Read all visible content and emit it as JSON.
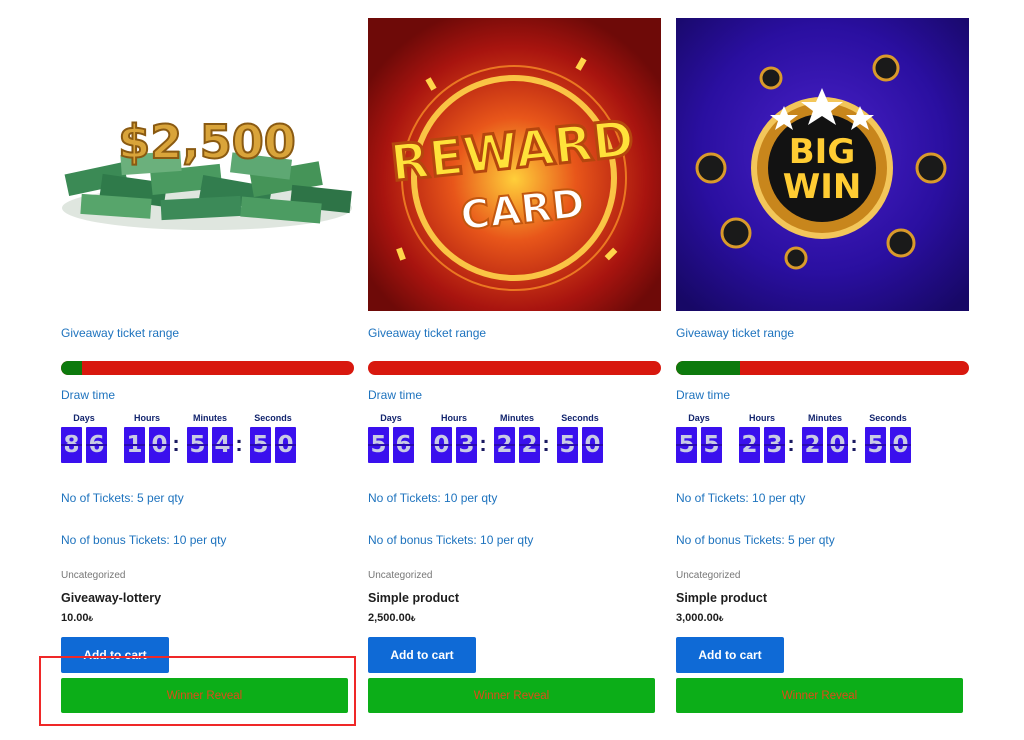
{
  "products": [
    {
      "image_text": "$2,500",
      "ticket_range_label": "Giveaway ticket range",
      "progress": 0.07,
      "draw_time_label": "Draw time",
      "countdown": {
        "days_label": "Days",
        "hours_label": "Hours",
        "minutes_label": "Minutes",
        "seconds_label": "Seconds",
        "days": "86",
        "hours": "10",
        "minutes": "54",
        "seconds": "50"
      },
      "tickets": "No of Tickets: 5 per qty",
      "bonus_tickets": "No of bonus Tickets: 10 per qty",
      "category": "Uncategorized",
      "title": "Giveaway-lottery",
      "price": "10.00",
      "currency": "₺",
      "add_to_cart": "Add to cart",
      "winner_reveal": "Winner Reveal"
    },
    {
      "image_text": "REWARD CARD",
      "ticket_range_label": "Giveaway ticket range",
      "progress": 0.0,
      "draw_time_label": "Draw time",
      "countdown": {
        "days_label": "Days",
        "hours_label": "Hours",
        "minutes_label": "Minutes",
        "seconds_label": "Seconds",
        "days": "56",
        "hours": "03",
        "minutes": "22",
        "seconds": "50"
      },
      "tickets": "No of Tickets: 10 per qty",
      "bonus_tickets": "No of bonus Tickets: 10 per qty",
      "category": "Uncategorized",
      "title": "Simple product",
      "price": "2,500.00",
      "currency": "₺",
      "add_to_cart": "Add to cart",
      "winner_reveal": "Winner Reveal"
    },
    {
      "image_text": "BIG WIN",
      "ticket_range_label": "Giveaway ticket range",
      "progress": 0.22,
      "draw_time_label": "Draw time",
      "countdown": {
        "days_label": "Days",
        "hours_label": "Hours",
        "minutes_label": "Minutes",
        "seconds_label": "Seconds",
        "days": "55",
        "hours": "23",
        "minutes": "20",
        "seconds": "50"
      },
      "tickets": "No of Tickets: 10 per qty",
      "bonus_tickets": "No of bonus Tickets: 5 per qty",
      "category": "Uncategorized",
      "title": "Simple product",
      "price": "3,000.00",
      "currency": "₺",
      "add_to_cart": "Add to cart",
      "winner_reveal": "Winner Reveal"
    }
  ],
  "colors": {
    "link": "#1e73be",
    "progress_track": "#d8180e",
    "progress_fill": "#0d7a0d",
    "countdown_digit_bg": "#3a10ee",
    "add_to_cart_bg": "#0f6ad6",
    "winner_reveal_bg": "#0cae18",
    "winner_reveal_text": "#e04a18",
    "highlight_border": "#ef2828"
  }
}
